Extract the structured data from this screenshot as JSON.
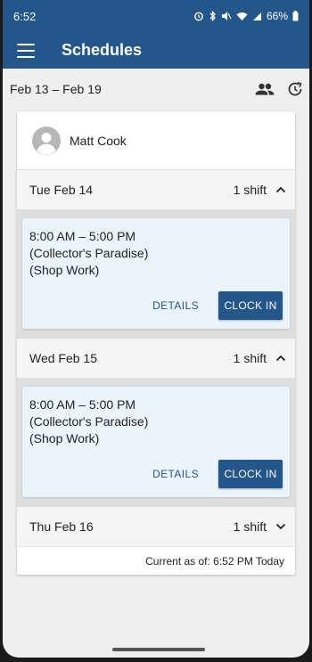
{
  "status": {
    "time": "6:52",
    "battery": "66%"
  },
  "app": {
    "title": "Schedules"
  },
  "week": {
    "range": "Feb 13 – Feb 19"
  },
  "employee": {
    "name": "Matt Cook"
  },
  "days": [
    {
      "label": "Tue Feb 14",
      "shift_count": "1 shift",
      "shift": {
        "time": "8:00 AM – 5:00 PM",
        "location": "(Collector's Paradise)",
        "position": "(Shop Work)",
        "details_label": "DETAILS",
        "clockin_label": "CLOCK IN"
      }
    },
    {
      "label": "Wed Feb 15",
      "shift_count": "1 shift",
      "shift": {
        "time": "8:00 AM – 5:00 PM",
        "location": "(Collector's Paradise)",
        "position": "(Shop Work)",
        "details_label": "DETAILS",
        "clockin_label": "CLOCK IN"
      }
    },
    {
      "label": "Thu Feb 16",
      "shift_count": "1 shift"
    }
  ],
  "footer": {
    "current_as_of": "Current as of: 6:52 PM Today"
  },
  "colors": {
    "primary": "#23578c",
    "shift_bg": "#ebf4fa",
    "page_bg": "#efefef"
  }
}
